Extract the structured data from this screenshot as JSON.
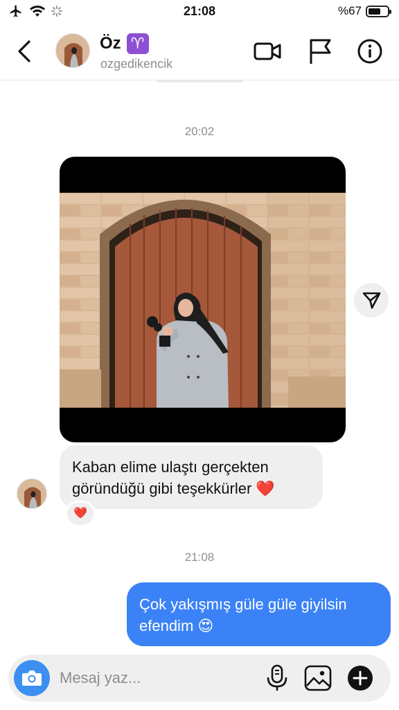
{
  "status_bar": {
    "time": "21:08",
    "battery_text": "%67",
    "battery_level": 0.67
  },
  "header": {
    "name": "Öz",
    "zodiac_emoji": "♈",
    "username": "ozgedikencik",
    "icons": {
      "back": "chevron-left-icon",
      "video": "video-camera-icon",
      "flag": "flag-icon",
      "info": "info-icon"
    }
  },
  "thread": {
    "timestamp_1": "20:02",
    "received_message": "Kaban elime ulaştı gerçekten göründüğü gibi teşekkürler ❤️",
    "reaction": "❤️",
    "timestamp_2": "21:08",
    "sent_message": "Çok yakışmış güle güle giyilsin efendim 😍"
  },
  "composer": {
    "placeholder": "Mesaj yaz..."
  },
  "colors": {
    "sent_bubble": "#3b82f6",
    "received_bubble": "#efefef",
    "camera_button": "#3d8ff2",
    "zodiac_badge": "#8d4fd3"
  }
}
